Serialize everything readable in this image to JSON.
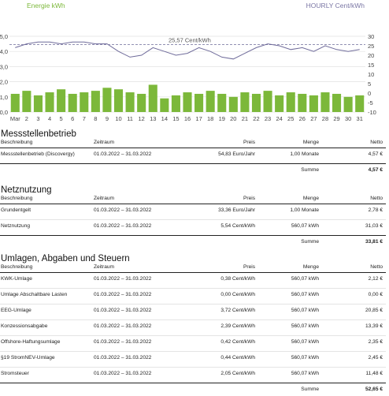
{
  "chart": {
    "left_label": "Energie kWh",
    "right_label": "HOURLY Cent/kWh",
    "left_ticks": [
      "5,0",
      "4,0",
      "3,0",
      "2,0",
      "1,0",
      "0,0"
    ],
    "right_ticks": [
      "30",
      "25",
      "20",
      "15",
      "10",
      "5",
      "0",
      "-5",
      "-10"
    ],
    "x_labels": [
      "Mar",
      "2",
      "3",
      "4",
      "5",
      "6",
      "7",
      "8",
      "9",
      "10",
      "11",
      "12",
      "13",
      "14",
      "15",
      "16",
      "17",
      "18",
      "19",
      "20",
      "21",
      "22",
      "23",
      "24",
      "25",
      "26",
      "27",
      "28",
      "29",
      "30",
      "31"
    ],
    "avg_label": "25,57 Cent/kWh",
    "avg_value_cent": 25.57,
    "bar_color": "#7cb83a",
    "line_color": "#6f6b9a"
  },
  "chart_data": {
    "type": "bar",
    "title": "",
    "xlabel": "",
    "ylabel": "Energie kWh",
    "y2label": "HOURLY Cent/kWh",
    "ylim": [
      0,
      5
    ],
    "y2lim": [
      -10,
      30
    ],
    "categories": [
      "Mar",
      "2",
      "3",
      "4",
      "5",
      "6",
      "7",
      "8",
      "9",
      "10",
      "11",
      "12",
      "13",
      "14",
      "15",
      "16",
      "17",
      "18",
      "19",
      "20",
      "21",
      "22",
      "23",
      "24",
      "25",
      "26",
      "27",
      "28",
      "29",
      "30",
      "31"
    ],
    "series": [
      {
        "name": "Energie kWh",
        "type": "bar",
        "values": [
          1.2,
          1.4,
          1.1,
          1.3,
          1.5,
          1.2,
          1.3,
          1.4,
          1.6,
          1.5,
          1.3,
          1.2,
          1.8,
          0.9,
          1.1,
          1.3,
          1.2,
          1.4,
          1.2,
          1.0,
          1.3,
          1.2,
          1.4,
          1.1,
          1.3,
          1.2,
          1.1,
          1.3,
          1.2,
          1.0,
          1.1
        ]
      },
      {
        "name": "HOURLY Cent/kWh",
        "type": "line",
        "values": [
          24,
          26,
          27,
          27,
          26,
          27,
          27,
          26,
          26,
          22,
          19,
          20,
          24,
          22,
          20,
          21,
          24,
          22,
          19,
          18,
          21,
          24,
          26,
          25,
          23,
          24,
          22,
          25,
          23,
          22,
          23
        ]
      }
    ],
    "average_line": {
      "label": "25,57 Cent/kWh",
      "value": 25.57
    },
    "legend": "none",
    "grid": true
  },
  "sections": [
    {
      "title": "Messstellenbetrieb",
      "headers": [
        "Beschreibung",
        "Zeitraum",
        "Preis",
        "Menge",
        "Netto"
      ],
      "rows": [
        [
          "Messstellenbetrieb (Discovergy)",
          "01.03.2022 – 31.03.2022",
          "54,83 Euro/Jahr",
          "1,00 Monate",
          "4,57 €"
        ]
      ],
      "sum_label": "Summe",
      "sum_value": "4,57 €"
    },
    {
      "title": "Netznutzung",
      "headers": [
        "Beschreibung",
        "Zeitraum",
        "Preis",
        "Menge",
        "Netto"
      ],
      "rows": [
        [
          "Grundentgelt",
          "01.03.2022 – 31.03.2022",
          "33,36 Euro/Jahr",
          "1,00 Monate",
          "2,78 €"
        ],
        [
          "Netznutzung",
          "01.03.2022 – 31.03.2022",
          "5,54 Cent/kWh",
          "560,07 kWh",
          "31,03 €"
        ]
      ],
      "sum_label": "Summe",
      "sum_value": "33,81 €"
    },
    {
      "title": "Umlagen, Abgaben und Steuern",
      "headers": [
        "Beschreibung",
        "Zeitraum",
        "Preis",
        "Menge",
        "Netto"
      ],
      "rows": [
        [
          "KWK-Umlage",
          "01.03.2022 – 31.03.2022",
          "0,38 Cent/kWh",
          "560,07 kWh",
          "2,12 €"
        ],
        [
          "Umlage Abschaltbare Lasten",
          "01.03.2022 – 31.03.2022",
          "0,00 Cent/kWh",
          "560,07 kWh",
          "0,00 €"
        ],
        [
          "EEG-Umlage",
          "01.03.2022 – 31.03.2022",
          "3,72 Cent/kWh",
          "560,07 kWh",
          "20,85 €"
        ],
        [
          "Konzessionsabgabe",
          "01.03.2022 – 31.03.2022",
          "2,39 Cent/kWh",
          "560,07 kWh",
          "13,39 €"
        ],
        [
          "Offshore-Haftungsumlage",
          "01.03.2022 – 31.03.2022",
          "0,42 Cent/kWh",
          "560,07 kWh",
          "2,35 €"
        ],
        [
          "§19 StromNEV-Umlage",
          "01.03.2022 – 31.03.2022",
          "0,44 Cent/kWh",
          "560,07 kWh",
          "2,45 €"
        ],
        [
          "Stromsteuer",
          "01.03.2022 – 31.03.2022",
          "2,05 Cent/kWh",
          "560,07 kWh",
          "11,48 €"
        ]
      ],
      "sum_label": "Summe",
      "sum_value": "52,65 €"
    }
  ]
}
